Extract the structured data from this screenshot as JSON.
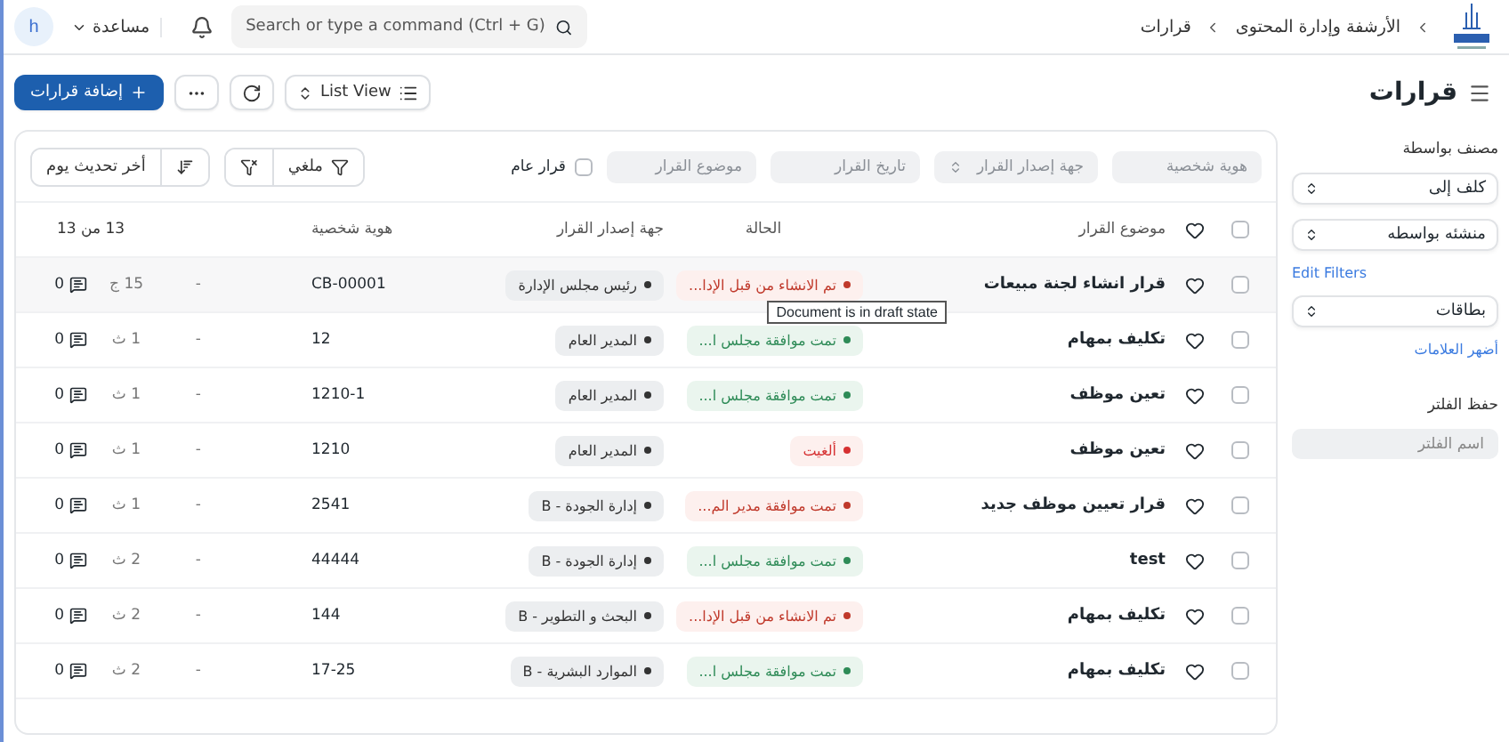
{
  "topbar": {
    "breadcrumbs": [
      "الأرشفة وإدارة المحتوى",
      "قرارات"
    ],
    "search": {
      "placeholder": "Search or type a command (Ctrl + G)"
    },
    "help": "مساعدة",
    "avatar": "h"
  },
  "page": {
    "title": "قرارات",
    "add_button": "إضافة قرارات",
    "view_button": "List View"
  },
  "sidebar": {
    "group_label": "مصنف بواسطة",
    "selects": [
      "كلف إلى",
      "منشئه بواسطه"
    ],
    "edit_filters": "Edit Filters",
    "tags_select": "بطاقات",
    "show_tags": "أضهر العلامات",
    "save_label": "حفظ الفلتر",
    "filter_name": {
      "placeholder": "اسم الفلتر"
    }
  },
  "filters": {
    "fields": [
      {
        "kind": "text",
        "placeholder": "هوية شخصية"
      },
      {
        "kind": "select",
        "placeholder": "جهة إصدار القرار"
      },
      {
        "kind": "text",
        "placeholder": "تاريخ القرار"
      },
      {
        "kind": "text",
        "placeholder": "موضوع القرار"
      }
    ],
    "public_checkbox": {
      "label": "قرار عام",
      "checked": false
    },
    "filter_button": "ملغي",
    "sort_button": "أخر تحديث يوم"
  },
  "table": {
    "all_checked": false,
    "columns": [
      "موضوع القرار",
      "الحالة",
      "جهة إصدار القرار",
      "هوية شخصية"
    ],
    "count": "13 من 13",
    "rows": [
      {
        "subject": "قرار انشاء لجنة مبيعات",
        "status": "تم الانشاء من قبل الإدا...",
        "color": "#c0392b",
        "issuer": "رئيس مجلس الإدارة",
        "id": "CB-00001",
        "dash": "-",
        "age": "15 ج",
        "comments": "0",
        "checked": false,
        "hovered": true
      },
      {
        "subject": "تكليف بمهام",
        "status": "تمت موافقة مجلس ا...",
        "color": "#2e8b57",
        "issuer": "المدير العام",
        "id": "12",
        "dash": "-",
        "age": "1 ث",
        "comments": "0",
        "checked": false,
        "hovered": false
      },
      {
        "subject": "تعين موظف",
        "status": "تمت موافقة مجلس ا...",
        "color": "#2e8b57",
        "issuer": "المدير العام",
        "id": "1210-1",
        "dash": "-",
        "age": "1 ث",
        "comments": "0",
        "checked": false,
        "hovered": false
      },
      {
        "subject": "تعين موظف",
        "status": "ألغيت",
        "color": "#d63031",
        "issuer": "المدير العام",
        "id": "1210",
        "dash": "-",
        "age": "1 ث",
        "comments": "0",
        "checked": false,
        "hovered": false
      },
      {
        "subject": "قرار تعيين موظف جديد",
        "status": "تمت موافقة مدير الم...",
        "color": "#c0392b",
        "issuer": "إدارة الجودة - B",
        "id": "2541",
        "dash": "-",
        "age": "1 ث",
        "comments": "0",
        "checked": false,
        "hovered": false
      },
      {
        "subject": "test",
        "status": "تمت موافقة مجلس ا...",
        "color": "#2e8b57",
        "issuer": "إدارة الجودة - B",
        "id": "44444",
        "dash": "-",
        "age": "2 ث",
        "comments": "0",
        "checked": false,
        "hovered": false
      },
      {
        "subject": "تكليف بمهام",
        "status": "تم الانشاء من قبل الإدا...",
        "color": "#c0392b",
        "issuer": "البحث و التطوير - B",
        "id": "144",
        "dash": "-",
        "age": "2 ث",
        "comments": "0",
        "checked": false,
        "hovered": false
      },
      {
        "subject": "تكليف بمهام",
        "status": "تمت موافقة مجلس ا...",
        "color": "#2e8b57",
        "issuer": "الموارد البشرية - B",
        "id": "17-25",
        "dash": "-",
        "age": "2 ث",
        "comments": "0",
        "checked": false,
        "hovered": false
      }
    ]
  },
  "tooltip": "Document is in draft state"
}
